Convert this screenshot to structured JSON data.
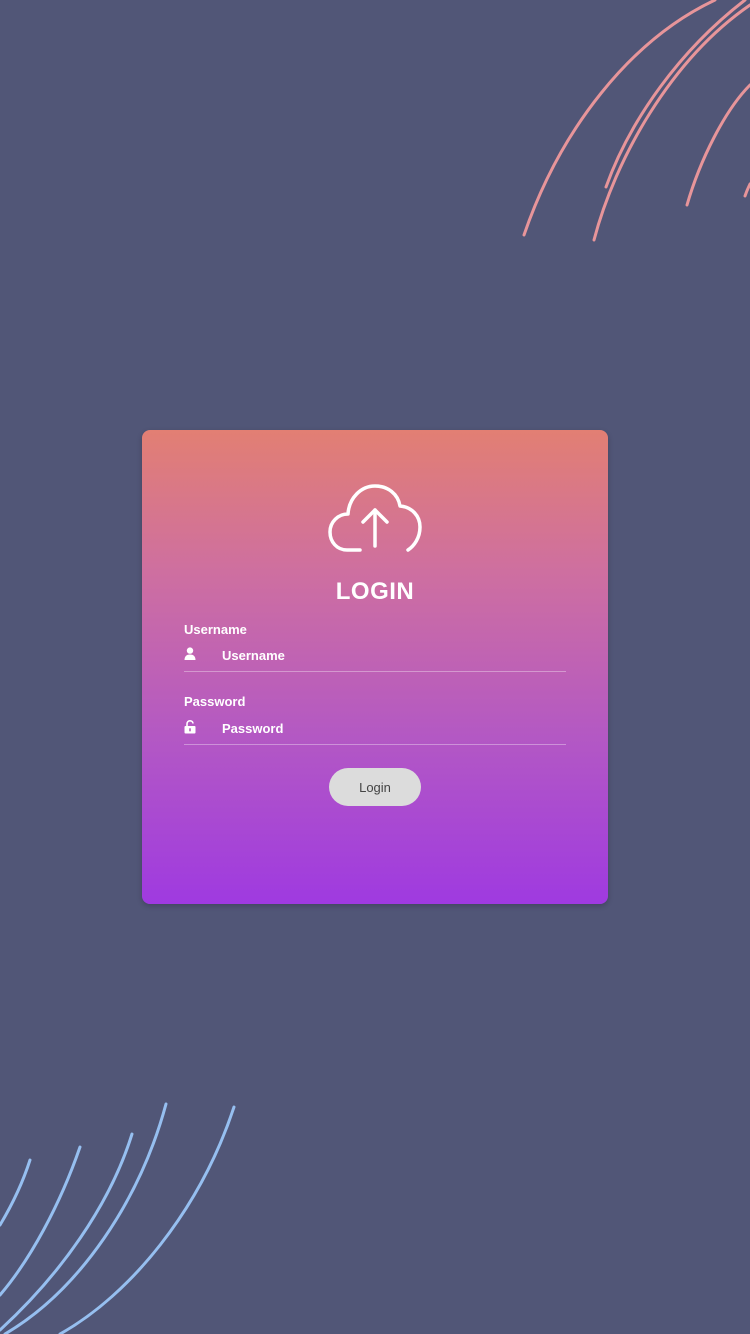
{
  "colors": {
    "background": "#515677",
    "card_gradient_top": "#e27f73",
    "card_gradient_bottom": "#9f3ae0",
    "deco_top_arcs": "#e7959a",
    "deco_bottom_arcs": "#96bff0",
    "button_bg": "#dcdcdc",
    "button_text": "#444444"
  },
  "login_card": {
    "icon": "cloud-upload-icon",
    "title": "LOGIN",
    "username": {
      "label": "Username",
      "icon": "user-icon",
      "placeholder": "Username",
      "value": ""
    },
    "password": {
      "label": "Password",
      "icon": "unlock-icon",
      "placeholder": "Password",
      "value": ""
    },
    "submit_label": "Login"
  }
}
